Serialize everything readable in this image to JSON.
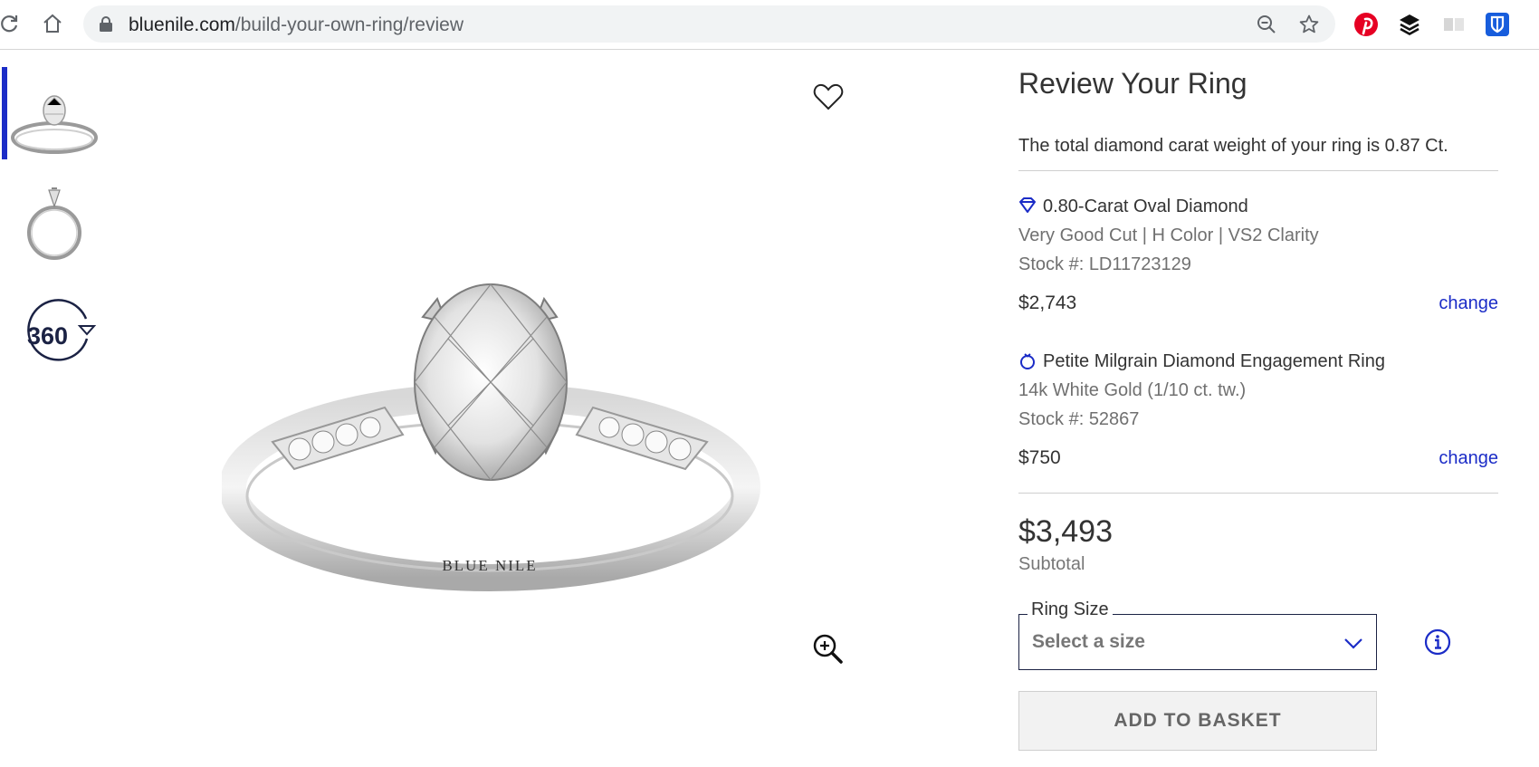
{
  "browser": {
    "url_host": "bluenile.com",
    "url_path": "/build-your-own-ring/review"
  },
  "gallery": {
    "views": [
      "ring-front-view",
      "ring-side-view",
      "360-view"
    ],
    "active_view": 0,
    "view_360_label": "360",
    "engraving": "BLUE NILE"
  },
  "review": {
    "title": "Review Your Ring",
    "carat_note": "The total diamond carat weight of your ring is 0.87 Ct.",
    "items": [
      {
        "icon": "diamond-icon",
        "title": "0.80-Carat Oval Diamond",
        "details": "Very Good Cut | H Color | VS2 Clarity",
        "stock": "Stock #: LD11723129",
        "price": "$2,743",
        "change_label": "change"
      },
      {
        "icon": "ring-icon",
        "title": "Petite Milgrain Diamond Engagement Ring",
        "details": "14k White Gold (1/10 ct. tw.)",
        "stock": "Stock #: 52867",
        "price": "$750",
        "change_label": "change"
      }
    ],
    "total": "$3,493",
    "subtotal_label": "Subtotal",
    "ring_size": {
      "label": "Ring Size",
      "placeholder": "Select a size"
    },
    "add_to_basket": "ADD TO BASKET"
  },
  "colors": {
    "accent_blue": "#1b2cc7",
    "navy": "#1b2244",
    "pinterest_red": "#e60023"
  }
}
